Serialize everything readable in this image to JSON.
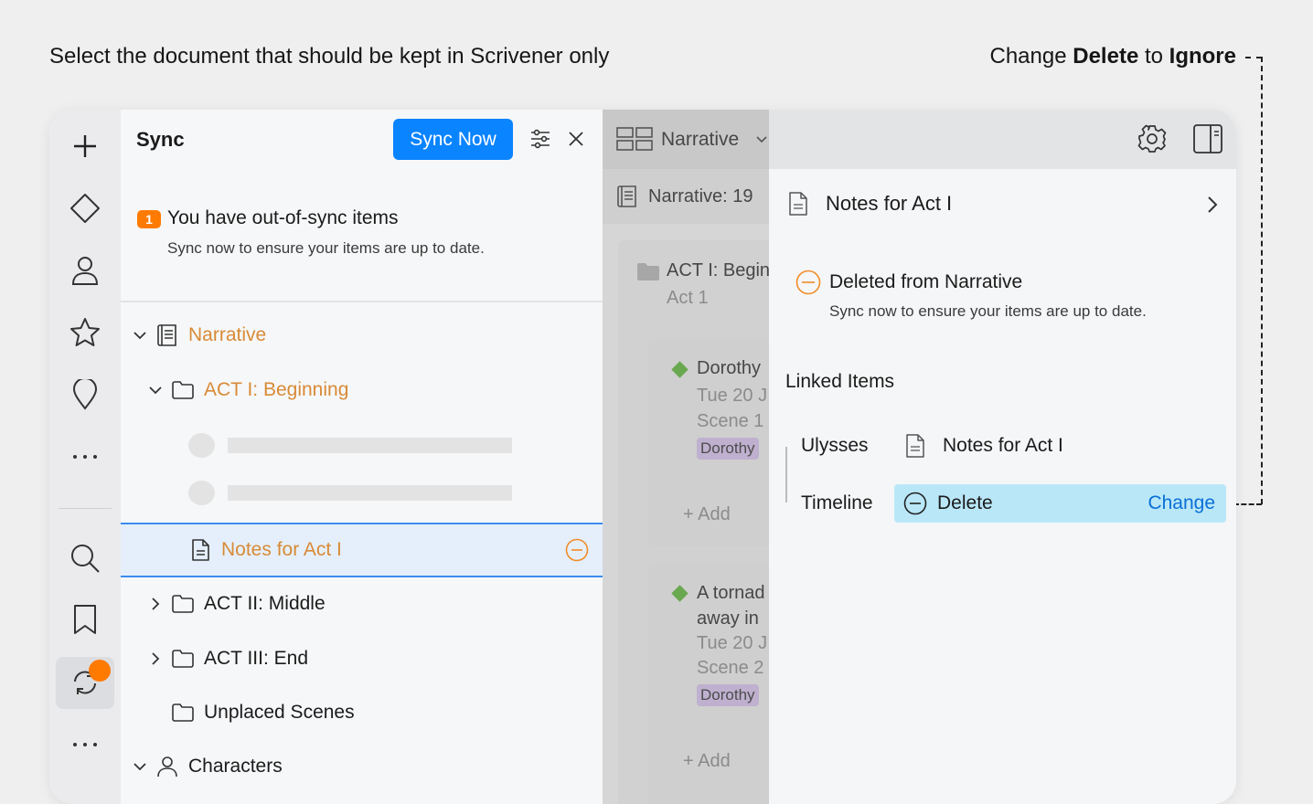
{
  "captions": {
    "left": "Select the document that should be kept in Scrivener only",
    "right_prefix": "Change ",
    "right_bold1": "Delete",
    "right_mid": " to ",
    "right_bold2": "Ignore"
  },
  "sync_panel": {
    "title": "Sync",
    "sync_now": "Sync Now",
    "out_of_sync": {
      "count": "1",
      "title": "You have out-of-sync items",
      "subtitle": "Sync now to ensure your items are up to date."
    },
    "tree": {
      "narrative": "Narrative",
      "act1": "ACT I: Beginning",
      "selected_doc": "Notes for Act I",
      "act2": "ACT II: Middle",
      "act3": "ACT III: End",
      "unplaced": "Unplaced Scenes",
      "characters": "Characters"
    }
  },
  "middle": {
    "view_label": "Narrative",
    "subheader": "Narrative: 19",
    "folder_title": "ACT I: Begin",
    "folder_sub": "Act 1",
    "card1": {
      "title": "Dorothy",
      "date": "Tue 20 J",
      "scene": "Scene 1",
      "tag": "Dorothy"
    },
    "add_label": "Add",
    "card2": {
      "title_line1": "A tornad",
      "title_line2": "away in",
      "date": "Tue 20 J",
      "scene": "Scene 2",
      "tag": "Dorothy"
    },
    "add_label2": "Add"
  },
  "inspector": {
    "doc_title": "Notes for Act I",
    "status_title": "Deleted from Narrative",
    "status_sub": "Sync now to ensure your items are up to date.",
    "linked_items_label": "Linked Items",
    "linked": [
      {
        "app": "Ulysses",
        "value": "Notes for Act I"
      },
      {
        "app": "Timeline",
        "value": "Delete",
        "action": "Change"
      }
    ]
  },
  "colors": {
    "accent_blue": "#0a84ff",
    "warning_orange": "#ff7a00",
    "selected_row": "#e5effb",
    "delete_highlight": "#b9e7f8"
  }
}
